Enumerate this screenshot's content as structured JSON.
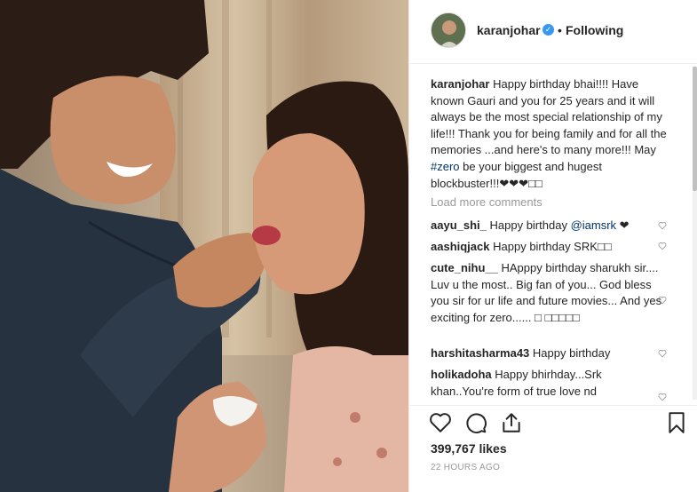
{
  "post": {
    "username": "karanjohar",
    "follow_status": "Following",
    "separator": "•"
  },
  "caption": {
    "author": "karanjohar",
    "text_before_tag": "Happy birthday bhai!!!! Have known Gauri and you for 25 years and it will always be the most special relationship of my life!!! Thank you for being family and for all the memories ...and here's to many more!!! May ",
    "hashtag": "#zero",
    "text_after_tag": " be your biggest and hugest blockbuster!!!❤❤❤□□"
  },
  "load_more": "Load more comments",
  "comments": [
    {
      "user": "aayu_shi_",
      "text": "Happy birthday ",
      "mention": "@iamsrk",
      "suffix": " ❤"
    },
    {
      "user": "aashiqjack",
      "text": "Happy birthday SRK□□",
      "mention": "",
      "suffix": ""
    },
    {
      "user": "cute_nihu__",
      "text": "HApppy birthday sharukh sir.... Luv u the most.. Big fan of you... God bless you sir for ur life and future movies... And yes exciting for zero...... □ □□□□□",
      "mention": "",
      "suffix": ""
    },
    {
      "user": "harshitasharma43",
      "text": "Happy birthday",
      "mention": "",
      "suffix": ""
    },
    {
      "user": "holikadoha",
      "text": "Happy bhirhday...Srk khan..You're form of true love nd",
      "mention": "",
      "suffix": ""
    }
  ],
  "likes": "399,767 likes",
  "timestamp": "22 HOURS AGO",
  "icons": {
    "verified": "verified-badge-icon",
    "like": "heart-icon",
    "comment": "comment-bubble-icon",
    "share": "share-icon",
    "save": "bookmark-icon"
  },
  "colors": {
    "verified": "#3897f0",
    "link": "#003569",
    "muted": "#999999",
    "text": "#262626"
  }
}
